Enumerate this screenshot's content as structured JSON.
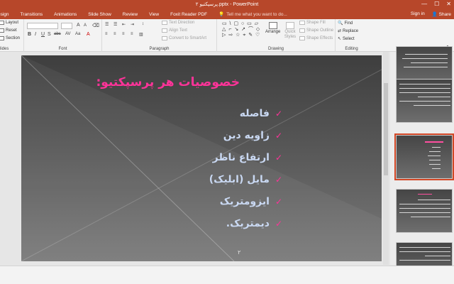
{
  "window": {
    "title": "پرسپکتیو ۲.pptx - PowerPoint",
    "controls": [
      "—",
      "☐",
      "✕"
    ]
  },
  "ribbon_tabs": [
    "esign",
    "Transitions",
    "Animations",
    "Slide Show",
    "Review",
    "View",
    "Foxit Reader PDF"
  ],
  "tell_me": "Tell me what you want to do...",
  "account": {
    "sign_in": "Sign in",
    "share": "Share"
  },
  "ribbon": {
    "slides": {
      "label": "lides",
      "layout": "Layout",
      "reset": "Reset",
      "section": "Section"
    },
    "font": {
      "label": "Font",
      "bold": "B",
      "italic": "I",
      "underline": "U",
      "strike": "S",
      "shadow": "abc",
      "spacing": "AV",
      "case": "Aa",
      "grow": "A",
      "shrink": "A",
      "color": "A"
    },
    "paragraph": {
      "label": "Paragraph",
      "text_direction": "Text Direction",
      "align_text": "Align Text",
      "convert_smartart": "Convert to SmartArt"
    },
    "drawing": {
      "label": "Drawing",
      "arrange": "Arrange",
      "quick_styles": "Quick Styles",
      "shape_fill": "Shape Fill",
      "shape_outline": "Shape Outline",
      "shape_effects": "Shape Effects"
    },
    "editing": {
      "label": "Editing",
      "find": "Find",
      "replace": "Replace",
      "select": "Select"
    }
  },
  "slide": {
    "title": "خصوصیات هر پرسپکتیو:",
    "bullets": [
      "فاصله",
      "زاویه دین",
      "ارتفاع ناظر",
      "مایل (ابلیک)",
      "ایزومتریک",
      "دیمتریک."
    ],
    "bullet_symbol": "✓",
    "number": "۲"
  },
  "colors": {
    "accent": "#b7472a",
    "title_pink": "#ff3399",
    "bullet_text": "#c9d8f2"
  },
  "icons": {
    "shape_gallery": "▭ \\ ▢ ○ ▭ ▱ △ ⌐ ↘ ↗ ⌒ ◇ ▷ ⇨ ☆ ⌖ ✎ ♡"
  }
}
